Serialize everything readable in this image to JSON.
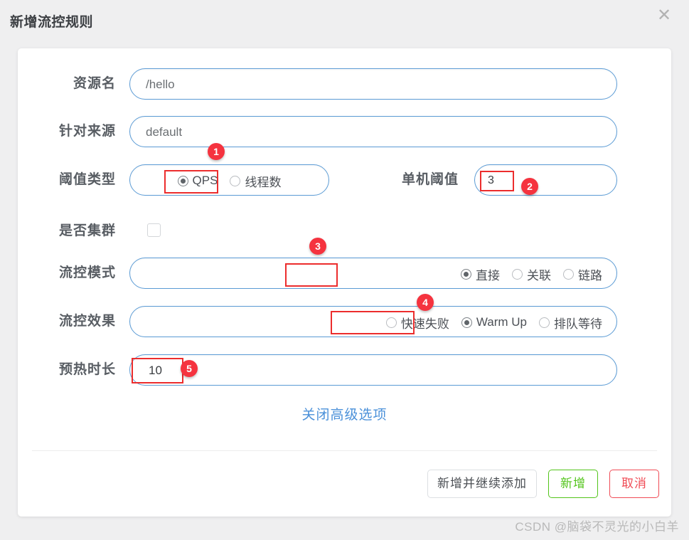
{
  "dialog": {
    "title": "新增流控规则",
    "close_icon": "close-icon",
    "close_glyph": "✕"
  },
  "form": {
    "resource": {
      "label": "资源名",
      "value": "/hello",
      "placeholder": "资源名"
    },
    "origin": {
      "label": "针对来源",
      "value": "default",
      "placeholder": "default"
    },
    "threshold_type": {
      "label": "阈值类型",
      "options": [
        "QPS",
        "线程数"
      ],
      "selected": "QPS"
    },
    "single_threshold": {
      "label": "单机阈值",
      "value": "3",
      "placeholder": ""
    },
    "is_cluster": {
      "label": "是否集群",
      "checked": false
    },
    "flow_mode": {
      "label": "流控模式",
      "options": [
        "直接",
        "关联",
        "链路"
      ],
      "selected": "直接"
    },
    "flow_effect": {
      "label": "流控效果",
      "options": [
        "快速失败",
        "Warm Up",
        "排队等待"
      ],
      "selected": "Warm Up"
    },
    "warmup_duration": {
      "label": "预热时长",
      "value": "10",
      "placeholder": ""
    }
  },
  "advanced_link": "关闭高级选项",
  "footer": {
    "add_and_continue": "新增并继续添加",
    "add": "新增",
    "cancel": "取消"
  },
  "annotations": {
    "badges": [
      "1",
      "2",
      "3",
      "4",
      "5"
    ]
  },
  "watermark": "CSDN @脑袋不灵光的小白羊",
  "colors": {
    "accent_blue": "#5b9bd5",
    "link_blue": "#4a90d9",
    "annotation_red": "#ec2d2d",
    "badge_red": "#f5333f",
    "primary_green": "#52c41a",
    "danger_red": "#f04b55",
    "background": "#efeff0"
  }
}
